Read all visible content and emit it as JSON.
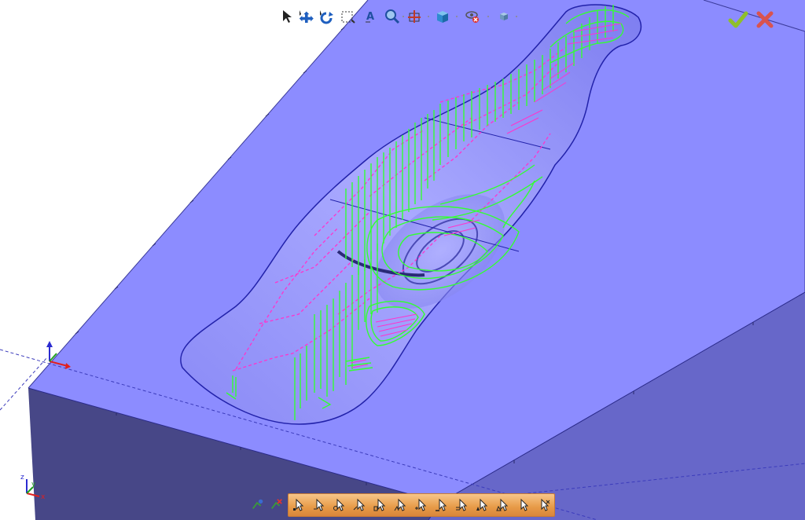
{
  "viewport": {
    "colors": {
      "stock_top": "#8c8cff",
      "stock_right_side": "#6666c8",
      "stock_front_side": "#474787",
      "toolpath_rapid": "#ff33cc",
      "toolpath_cut": "#33ff33",
      "background": "#ffffff"
    },
    "top_toolbar": {
      "tools": [
        {
          "name": "select-icon"
        },
        {
          "name": "move-icon"
        },
        {
          "name": "rotate-icon"
        },
        {
          "name": "box-zoom-icon"
        },
        {
          "name": "zoom-text-icon"
        },
        {
          "name": "zoom-icon"
        },
        {
          "name": "pan-center-icon"
        },
        {
          "name": "view-cube-icon"
        },
        {
          "name": "visibility-icon"
        },
        {
          "name": "small-cube-icon"
        }
      ]
    },
    "confirm": {
      "ok_icon": "checkmark-icon",
      "cancel_icon": "x-icon"
    },
    "triad_top": {
      "labels": [
        "z",
        "x"
      ]
    },
    "triad_bottom": {
      "labels": [
        "z",
        "y",
        "x"
      ]
    },
    "bottom_toolbar": {
      "tools": [
        "cursor-tool-1",
        "cursor-tool-2",
        "cursor-tool-3",
        "cursor-tool-4",
        "cursor-tool-5",
        "cursor-tool-6",
        "cursor-tool-7",
        "cursor-tool-8",
        "cursor-tool-9",
        "cursor-tool-10",
        "cursor-tool-11",
        "cursor-tool-12",
        "cursor-tool-13"
      ]
    }
  }
}
